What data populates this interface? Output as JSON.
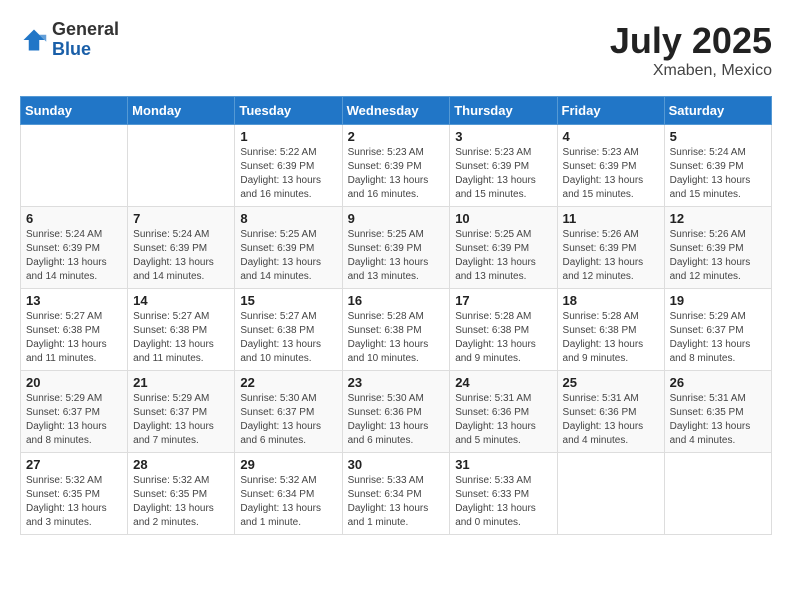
{
  "header": {
    "logo_general": "General",
    "logo_blue": "Blue",
    "month_year": "July 2025",
    "location": "Xmaben, Mexico"
  },
  "days_of_week": [
    "Sunday",
    "Monday",
    "Tuesday",
    "Wednesday",
    "Thursday",
    "Friday",
    "Saturday"
  ],
  "weeks": [
    [
      {
        "day": "",
        "info": ""
      },
      {
        "day": "",
        "info": ""
      },
      {
        "day": "1",
        "info": "Sunrise: 5:22 AM\nSunset: 6:39 PM\nDaylight: 13 hours and 16 minutes."
      },
      {
        "day": "2",
        "info": "Sunrise: 5:23 AM\nSunset: 6:39 PM\nDaylight: 13 hours and 16 minutes."
      },
      {
        "day": "3",
        "info": "Sunrise: 5:23 AM\nSunset: 6:39 PM\nDaylight: 13 hours and 15 minutes."
      },
      {
        "day": "4",
        "info": "Sunrise: 5:23 AM\nSunset: 6:39 PM\nDaylight: 13 hours and 15 minutes."
      },
      {
        "day": "5",
        "info": "Sunrise: 5:24 AM\nSunset: 6:39 PM\nDaylight: 13 hours and 15 minutes."
      }
    ],
    [
      {
        "day": "6",
        "info": "Sunrise: 5:24 AM\nSunset: 6:39 PM\nDaylight: 13 hours and 14 minutes."
      },
      {
        "day": "7",
        "info": "Sunrise: 5:24 AM\nSunset: 6:39 PM\nDaylight: 13 hours and 14 minutes."
      },
      {
        "day": "8",
        "info": "Sunrise: 5:25 AM\nSunset: 6:39 PM\nDaylight: 13 hours and 14 minutes."
      },
      {
        "day": "9",
        "info": "Sunrise: 5:25 AM\nSunset: 6:39 PM\nDaylight: 13 hours and 13 minutes."
      },
      {
        "day": "10",
        "info": "Sunrise: 5:25 AM\nSunset: 6:39 PM\nDaylight: 13 hours and 13 minutes."
      },
      {
        "day": "11",
        "info": "Sunrise: 5:26 AM\nSunset: 6:39 PM\nDaylight: 13 hours and 12 minutes."
      },
      {
        "day": "12",
        "info": "Sunrise: 5:26 AM\nSunset: 6:39 PM\nDaylight: 13 hours and 12 minutes."
      }
    ],
    [
      {
        "day": "13",
        "info": "Sunrise: 5:27 AM\nSunset: 6:38 PM\nDaylight: 13 hours and 11 minutes."
      },
      {
        "day": "14",
        "info": "Sunrise: 5:27 AM\nSunset: 6:38 PM\nDaylight: 13 hours and 11 minutes."
      },
      {
        "day": "15",
        "info": "Sunrise: 5:27 AM\nSunset: 6:38 PM\nDaylight: 13 hours and 10 minutes."
      },
      {
        "day": "16",
        "info": "Sunrise: 5:28 AM\nSunset: 6:38 PM\nDaylight: 13 hours and 10 minutes."
      },
      {
        "day": "17",
        "info": "Sunrise: 5:28 AM\nSunset: 6:38 PM\nDaylight: 13 hours and 9 minutes."
      },
      {
        "day": "18",
        "info": "Sunrise: 5:28 AM\nSunset: 6:38 PM\nDaylight: 13 hours and 9 minutes."
      },
      {
        "day": "19",
        "info": "Sunrise: 5:29 AM\nSunset: 6:37 PM\nDaylight: 13 hours and 8 minutes."
      }
    ],
    [
      {
        "day": "20",
        "info": "Sunrise: 5:29 AM\nSunset: 6:37 PM\nDaylight: 13 hours and 8 minutes."
      },
      {
        "day": "21",
        "info": "Sunrise: 5:29 AM\nSunset: 6:37 PM\nDaylight: 13 hours and 7 minutes."
      },
      {
        "day": "22",
        "info": "Sunrise: 5:30 AM\nSunset: 6:37 PM\nDaylight: 13 hours and 6 minutes."
      },
      {
        "day": "23",
        "info": "Sunrise: 5:30 AM\nSunset: 6:36 PM\nDaylight: 13 hours and 6 minutes."
      },
      {
        "day": "24",
        "info": "Sunrise: 5:31 AM\nSunset: 6:36 PM\nDaylight: 13 hours and 5 minutes."
      },
      {
        "day": "25",
        "info": "Sunrise: 5:31 AM\nSunset: 6:36 PM\nDaylight: 13 hours and 4 minutes."
      },
      {
        "day": "26",
        "info": "Sunrise: 5:31 AM\nSunset: 6:35 PM\nDaylight: 13 hours and 4 minutes."
      }
    ],
    [
      {
        "day": "27",
        "info": "Sunrise: 5:32 AM\nSunset: 6:35 PM\nDaylight: 13 hours and 3 minutes."
      },
      {
        "day": "28",
        "info": "Sunrise: 5:32 AM\nSunset: 6:35 PM\nDaylight: 13 hours and 2 minutes."
      },
      {
        "day": "29",
        "info": "Sunrise: 5:32 AM\nSunset: 6:34 PM\nDaylight: 13 hours and 1 minute."
      },
      {
        "day": "30",
        "info": "Sunrise: 5:33 AM\nSunset: 6:34 PM\nDaylight: 13 hours and 1 minute."
      },
      {
        "day": "31",
        "info": "Sunrise: 5:33 AM\nSunset: 6:33 PM\nDaylight: 13 hours and 0 minutes."
      },
      {
        "day": "",
        "info": ""
      },
      {
        "day": "",
        "info": ""
      }
    ]
  ]
}
